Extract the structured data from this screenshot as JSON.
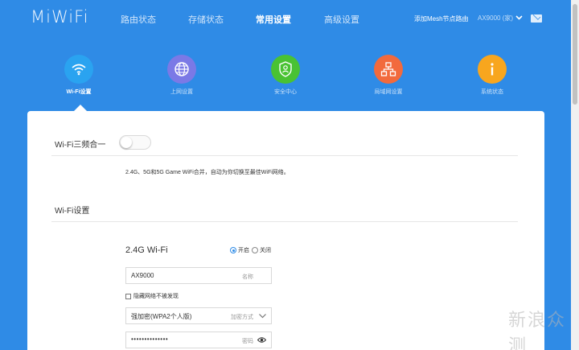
{
  "brand": {
    "logo": "MiWiFi"
  },
  "nav": {
    "items": [
      {
        "label": "路由状态",
        "active": false
      },
      {
        "label": "存储状态",
        "active": false
      },
      {
        "label": "常用设置",
        "active": true
      },
      {
        "label": "高级设置",
        "active": false
      }
    ],
    "mesh_link": "添加Mesh节点路由",
    "device": "AX9000 (家)"
  },
  "features": [
    {
      "label": "Wi-Fi设置",
      "icon": "wifi-icon",
      "color": "#2aa3f0",
      "active": true
    },
    {
      "label": "上网设置",
      "icon": "globe-icon",
      "color": "#7b79e6",
      "active": false
    },
    {
      "label": "安全中心",
      "icon": "shield-icon",
      "color": "#49c233",
      "active": false
    },
    {
      "label": "局域网设置",
      "icon": "network-icon",
      "color": "#f26a3d",
      "active": false
    },
    {
      "label": "系统状态",
      "icon": "info-icon",
      "color": "#f8a61e",
      "active": false
    }
  ],
  "triband": {
    "title": "Wi-Fi三频合一",
    "enabled": false,
    "description": "2.4G、5G和5G Game WiFi合并，自动为你切换至最佳WiFi网络。"
  },
  "wifi_settings": {
    "title": "Wi-Fi设置",
    "band": "2.4G Wi-Fi",
    "radio_on": "开启",
    "radio_off": "关闭",
    "ssid_value": "AX9000",
    "ssid_hint": "名称",
    "hide_network_label": "隐藏网络不被发现",
    "encryption_value": "强加密(WPA2个人版)",
    "encryption_hint": "加密方式",
    "password_value": "••••••••••••••",
    "password_hint": "密码"
  },
  "watermark": "新浪众测",
  "colors": {
    "header_bg": "#2f8be6",
    "accent": "#2f8be6"
  }
}
